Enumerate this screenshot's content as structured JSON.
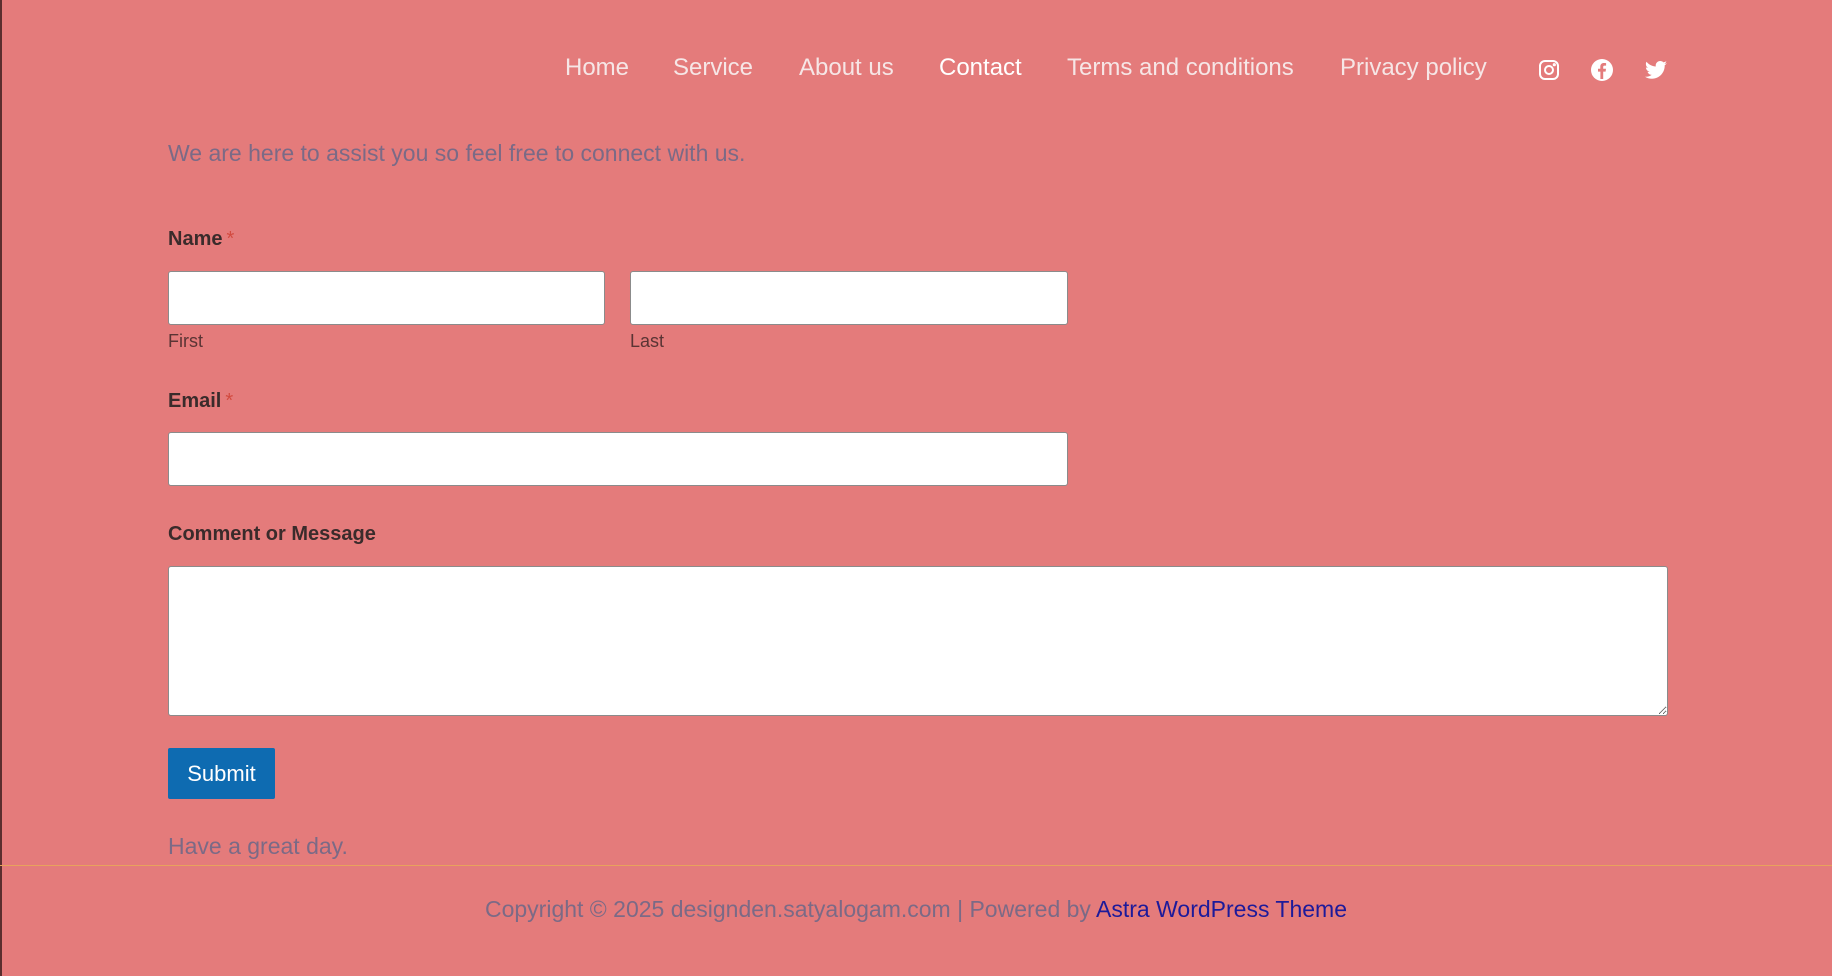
{
  "nav": {
    "items": [
      {
        "label": "Home"
      },
      {
        "label": "Service"
      },
      {
        "label": "About us"
      },
      {
        "label": "Contact"
      },
      {
        "label": "Terms and conditions"
      },
      {
        "label": "Privacy policy"
      }
    ],
    "active": "Contact",
    "social": [
      "instagram-icon",
      "facebook-icon",
      "twitter-icon"
    ]
  },
  "intro": "We are here to assist you so feel free to connect with us.",
  "form": {
    "name_label": "Name",
    "required_mark": "*",
    "first_sublabel": "First",
    "last_sublabel": "Last",
    "first_value": "",
    "last_value": "",
    "email_label": "Email",
    "email_value": "",
    "message_label": "Comment or Message",
    "message_value": "",
    "submit_label": "Submit"
  },
  "closing": "Have a great day.",
  "footer": {
    "text": "Copyright © 2025 designden.satyalogam.com | Powered by ",
    "link_label": "Astra WordPress Theme"
  },
  "colors": {
    "background": "#e47b7b",
    "button": "#0e6bb1",
    "link": "#1d1a9a",
    "muted_text": "#7b6a86",
    "required": "#d24a3f"
  }
}
